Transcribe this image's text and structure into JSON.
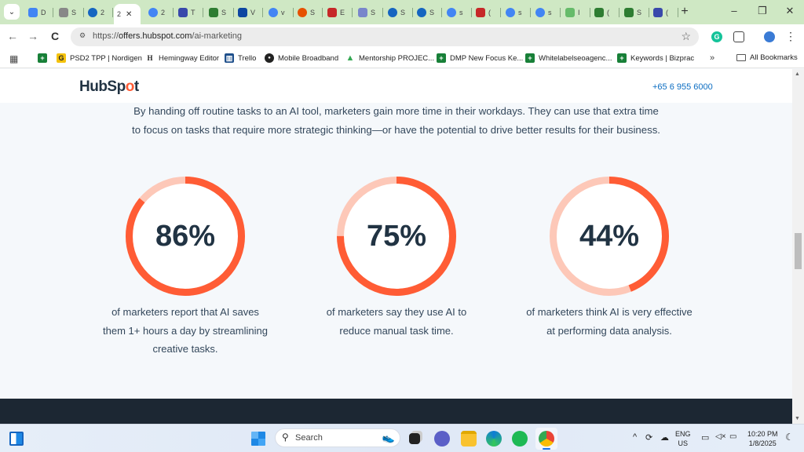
{
  "browser": {
    "tabs": [
      {
        "favicon": "docs-icon",
        "color": "#4285f4",
        "label": "D"
      },
      {
        "favicon": "openai-icon",
        "color": "#888888",
        "label": "S"
      },
      {
        "favicon": "blue-circle-icon",
        "color": "#1565c0",
        "label": "2"
      },
      {
        "favicon": "none",
        "color": "#ffffff",
        "label": "2",
        "active": true
      },
      {
        "favicon": "google-icon",
        "color": "#4285f4",
        "label": "2"
      },
      {
        "favicon": "tool-icon",
        "color": "#3949ab",
        "label": "T"
      },
      {
        "favicon": "semrush-icon",
        "color": "#2e7d32",
        "label": "S"
      },
      {
        "favicon": "cloud-icon",
        "color": "#0d47a1",
        "label": "V"
      },
      {
        "favicon": "google-icon",
        "color": "#4285f4",
        "label": "v"
      },
      {
        "favicon": "firefox-icon",
        "color": "#e65100",
        "label": "S"
      },
      {
        "favicon": "red-square-icon",
        "color": "#c62828",
        "label": "E"
      },
      {
        "favicon": "planet-icon",
        "color": "#7986cb",
        "label": "S"
      },
      {
        "favicon": "blue-circle-icon",
        "color": "#1565c0",
        "label": "S"
      },
      {
        "favicon": "blue-circle-icon",
        "color": "#1565c0",
        "label": "S"
      },
      {
        "favicon": "google-icon",
        "color": "#4285f4",
        "label": "s"
      },
      {
        "favicon": "gift-icon",
        "color": "#c62828",
        "label": "("
      },
      {
        "favicon": "google-icon",
        "color": "#4285f4",
        "label": "s"
      },
      {
        "favicon": "google-icon",
        "color": "#4285f4",
        "label": "s"
      },
      {
        "favicon": "wave-icon",
        "color": "#66bb6a",
        "label": "I"
      },
      {
        "favicon": "cross-icon",
        "color": "#2e7d32",
        "label": "("
      },
      {
        "favicon": "semrush-icon",
        "color": "#2e7d32",
        "label": "S"
      },
      {
        "favicon": "tool-icon",
        "color": "#3949ab",
        "label": "("
      }
    ],
    "new_tab": "+",
    "minimize": "–",
    "restore": "❐",
    "close": "✕",
    "back": "←",
    "forward": "→",
    "reload": "C",
    "url_scheme": "https://",
    "url_host": "offers.hubspot.com",
    "url_path": "/ai-marketing",
    "bookmark_star": "☆",
    "menu": "⋮",
    "bookmarks": [
      {
        "label": "PSD2 TPP | Nordigen",
        "icon": "nordigen-icon",
        "color": "#f4c20d",
        "glyph": "G"
      },
      {
        "label": "Hemingway Editor",
        "icon": "hemingway-icon",
        "color": "#ffffff",
        "glyph": "H"
      },
      {
        "label": "Trello",
        "icon": "trello-icon",
        "color": "#1e4f8b",
        "glyph": "▥"
      },
      {
        "label": "Mobile Broadband",
        "icon": "globe-icon",
        "color": "#222222",
        "glyph": "●"
      },
      {
        "label": "Mentorship PROJEC...",
        "icon": "drive-icon",
        "color": "#fbbc04",
        "glyph": "▲"
      },
      {
        "label": "DMP New Focus Ke...",
        "icon": "sheets-icon",
        "color": "#188038",
        "glyph": "+"
      },
      {
        "label": "Whitelabelseoagenc...",
        "icon": "sheets-icon",
        "color": "#188038",
        "glyph": "+"
      },
      {
        "label": "Keywords | Bizprac",
        "icon": "sheets-icon",
        "color": "#188038",
        "glyph": "+"
      }
    ],
    "more_bookmarks": "»",
    "all_bookmarks": "All Bookmarks"
  },
  "site": {
    "logo_pre": "HubSp",
    "logo_o": "o",
    "logo_post": "t",
    "phone": "+65 6 955 6000",
    "intro_line1": "By handing off routine tasks to an AI tool, marketers gain more time in their workdays. They can use that extra time",
    "intro_line2": "to focus on tasks that require more strategic thinking—or have the potential to drive better results for their business.",
    "accent": "#ff5c35",
    "track": "#fdc8b8",
    "stats": [
      {
        "value": 86,
        "label": "86%",
        "desc_lines": [
          "of marketers report that AI saves",
          "them 1+ hours a day by streamlining",
          "creative tasks."
        ]
      },
      {
        "value": 75,
        "label": "75%",
        "desc_lines": [
          "of marketers say they use AI to",
          "reduce manual task time."
        ]
      },
      {
        "value": 44,
        "label": "44%",
        "desc_lines": [
          "of marketers think AI is very effective",
          "at performing data analysis."
        ]
      }
    ]
  },
  "taskbar": {
    "search_label": "Search",
    "lang_top": "ENG",
    "lang_bottom": "US",
    "time": "10:20 PM",
    "date": "1/8/2025"
  }
}
